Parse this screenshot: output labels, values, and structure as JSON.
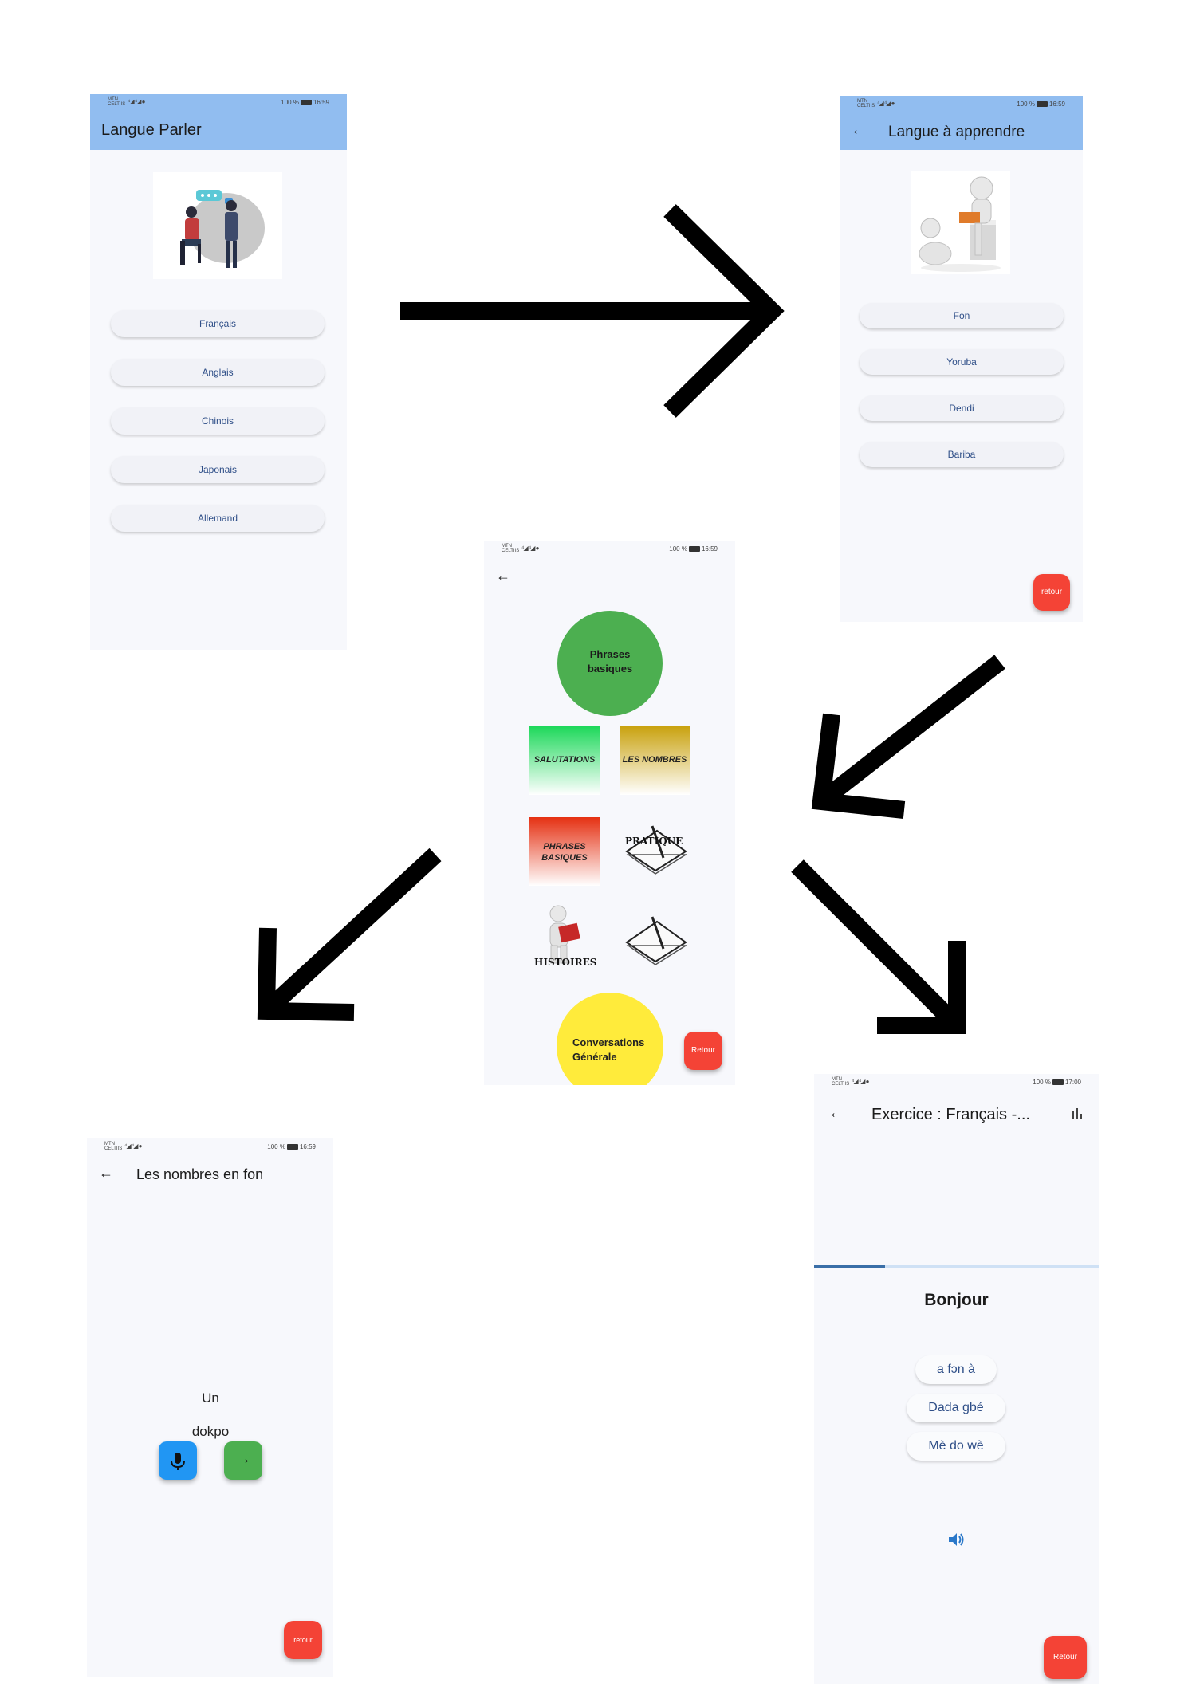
{
  "status": {
    "carrier": "MTN CELTIIS",
    "battery": "100 %",
    "time_a": "16:59",
    "time_b": "17:00"
  },
  "screen1": {
    "title": "Langue Parler",
    "languages": [
      "Français",
      "Anglais",
      "Chinois",
      "Japonais",
      "Allemand"
    ]
  },
  "screen2": {
    "title": "Langue à apprendre",
    "languages": [
      "Fon",
      "Yoruba",
      "Dendi",
      "Bariba"
    ],
    "fab_label": "retour"
  },
  "screen3": {
    "top_circle": "Phrases basiques",
    "tiles": {
      "salutations": "SALUTATIONS",
      "nombres": "LES NOMBRES",
      "phrases": "PHRASES BASIQUES",
      "pratique": "PRATIQUE",
      "histoires": "HISTOIRES"
    },
    "bottom_circle": "Conversations Générale",
    "fab_label": "Retour",
    "colors": {
      "green": "#4caf50",
      "yellow": "#ffeb3b",
      "red": "#f44336"
    }
  },
  "screen4": {
    "title": "Les nombres en fon",
    "word": "Un",
    "translation": "dokpo",
    "fab_label": "retour"
  },
  "screen5": {
    "title": "Exercice : Français -...",
    "progress": 0.25,
    "question": "Bonjour",
    "options": [
      "a fɔn à",
      "Dada gbé",
      "Mè do wè"
    ],
    "fab_label": "Retour"
  }
}
